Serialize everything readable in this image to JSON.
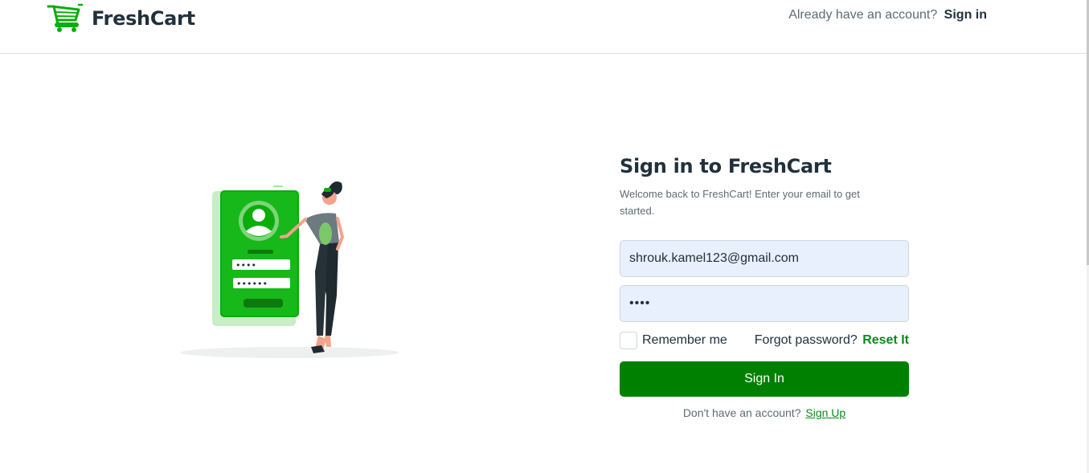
{
  "header": {
    "brand": "FreshCart",
    "account_question": "Already have an account?",
    "sign_in_link": "Sign in",
    "logo_icon": "shopping-cart-icon",
    "accent_color": "#0aad0a"
  },
  "illustration": {
    "icon": "login-phone-illustration",
    "password_dots_1": "••••",
    "password_dots_2": "••••••"
  },
  "form": {
    "title": "Sign in to FreshCart",
    "subtitle": "Welcome back to FreshCart! Enter your email to get started.",
    "email_value": "shrouk.kamel123@gmail.com",
    "password_value": "••••",
    "remember_label": "Remember me",
    "forgot_text": "Forgot password?",
    "reset_link": "Reset It",
    "submit_label": "Sign In",
    "signup_text": "Don't have an account?",
    "signup_link": "Sign Up",
    "button_color": "#008000"
  }
}
